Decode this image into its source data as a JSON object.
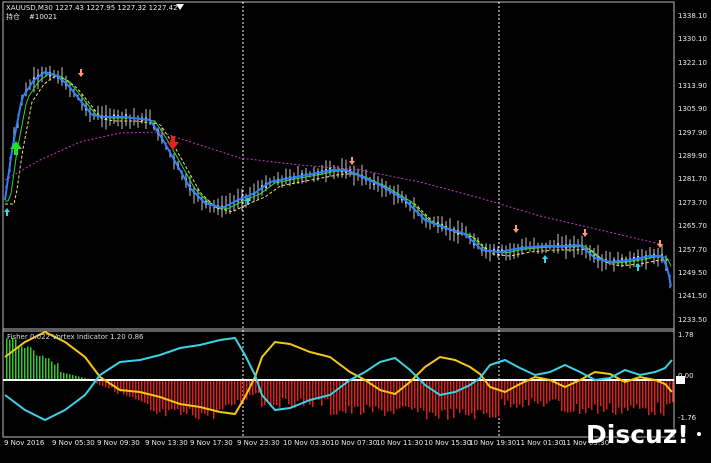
{
  "header": {
    "symbol_line": "XAUUSD,M30  1227.43  1227.95  1227.32  1227.42",
    "account_label": "持仓",
    "order_id": "#10021"
  },
  "indicator_header": "Fisher 0.022  Vortex Indicator 1.20 0.86",
  "price_scale": [
    "1338.10",
    "1330.10",
    "1322.10",
    "1313.90",
    "1305.90",
    "1297.90",
    "1289.90",
    "1281.70",
    "1273.70",
    "1265.70",
    "1257.70",
    "1249.50",
    "1241.50",
    "1233.50"
  ],
  "indicator_scale": [
    "1.78",
    "0.00",
    "-1.76"
  ],
  "time_labels": [
    "9 Nov 2016",
    "9 Nov 05:30",
    "9 Nov 09:30",
    "9 Nov 13:30",
    "9 Nov 17:30",
    "9 Nov 23:30",
    "10 Nov 03:30",
    "10 Nov 07:30",
    "10 Nov 11:30",
    "10 Nov 15:30",
    "10 Nov 19:30",
    "11 Nov 01:30",
    "11 Nov 05:30"
  ],
  "watermark": "Discuz!",
  "colors": {
    "background": "#000000",
    "candle": "#c8c8c8",
    "fast_ma": "#2f7dff",
    "green_ma": "#32d23c",
    "yellow_ma": "#f0e65a",
    "slow_ma": "#c832c8",
    "vortex_plus": "#3cd2e6",
    "vortex_minus": "#f5c814",
    "hist_pos": "#32c832",
    "hist_neg": "#dc1e1e",
    "zero_line": "#ffffff",
    "arrow_buy": "#3cd2e6",
    "arrow_sell": "#ff9a6a",
    "big_buy": "#20e020",
    "big_sell": "#e82020"
  }
}
